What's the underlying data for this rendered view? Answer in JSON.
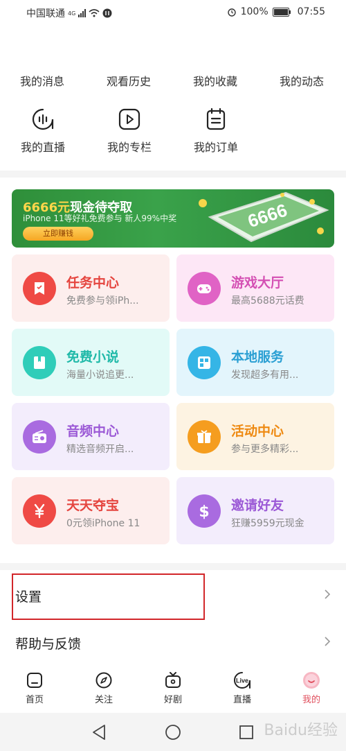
{
  "status_bar": {
    "carrier": "中国联通",
    "network": "4G",
    "battery": "100%",
    "time": "07:55"
  },
  "quick_links": [
    "我的消息",
    "观看历史",
    "我的收藏",
    "我的动态"
  ],
  "icon_links": [
    {
      "label": "我的直播",
      "icon": "live-wave-icon"
    },
    {
      "label": "我的专栏",
      "icon": "play-column-icon"
    },
    {
      "label": "我的订单",
      "icon": "order-clipboard-icon"
    }
  ],
  "banner": {
    "title_amount": "6666元",
    "title_rest": "现金待夺取",
    "subtitle": "iPhone 11等好礼免费参与  新人99%中奖",
    "button": "立即赚钱",
    "art_text": "6666"
  },
  "cards": [
    {
      "title": "任务中心",
      "subtitle": "免费参与领iPh...",
      "icon": "task-bookmark-icon",
      "title_color": "#e5453f",
      "bg": "#fdeeed",
      "circle": "#ef4a45"
    },
    {
      "title": "游戏大厅",
      "subtitle": "最高5688元话费",
      "icon": "gamepad-icon",
      "title_color": "#d44fb3",
      "bg": "#fde7f6",
      "circle": "#e063c5"
    },
    {
      "title": "免费小说",
      "subtitle": "海量小说追更...",
      "icon": "book-icon",
      "title_color": "#1fb9a8",
      "bg": "#e2faf7",
      "circle": "#2fcdb9"
    },
    {
      "title": "本地服务",
      "subtitle": "发现超多有用...",
      "icon": "local-grid-icon",
      "title_color": "#2a9fd3",
      "bg": "#e3f5fc",
      "circle": "#35b5e6"
    },
    {
      "title": "音频中心",
      "subtitle": "精选音频开启...",
      "icon": "radio-icon",
      "title_color": "#9b59d6",
      "bg": "#f3edfc",
      "circle": "#a96be0"
    },
    {
      "title": "活动中心",
      "subtitle": "参与更多精彩...",
      "icon": "gift-icon",
      "title_color": "#ee8a12",
      "bg": "#fdf3e2",
      "circle": "#f59d1f"
    },
    {
      "title": "天天夺宝",
      "subtitle": "0元领iPhone 11",
      "icon": "yuan-icon",
      "title_color": "#e5453f",
      "bg": "#fdeeed",
      "circle": "#ef4a45"
    },
    {
      "title": "邀请好友",
      "subtitle": "狂赚5959元现金",
      "icon": "dollar-icon",
      "title_color": "#9b59d6",
      "bg": "#f3edfc",
      "circle": "#a96be0"
    }
  ],
  "settings": {
    "settings_label": "设置",
    "help_label": "帮助与反馈"
  },
  "tabs": [
    {
      "label": "首页",
      "icon": "home-icon"
    },
    {
      "label": "关注",
      "icon": "compass-icon"
    },
    {
      "label": "好剧",
      "icon": "tv-icon"
    },
    {
      "label": "直播",
      "icon": "live-icon",
      "badge": "Live"
    },
    {
      "label": "我的",
      "icon": "profile-icon"
    }
  ],
  "watermark": "Baidu经验"
}
